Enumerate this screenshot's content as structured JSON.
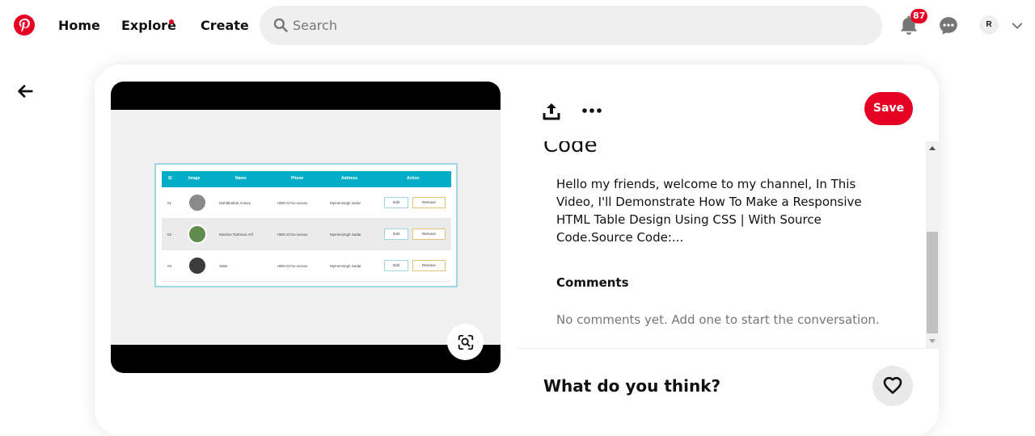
{
  "header": {
    "nav": {
      "home": "Home",
      "explore": "Explore",
      "create": "Create"
    },
    "search": {
      "placeholder": "Search",
      "value": ""
    },
    "notifications_count": "87",
    "avatar_initial": "R",
    "colors": {
      "brand": "#e60023",
      "search_bg": "#efefef"
    }
  },
  "pin": {
    "title": "Code",
    "description": "Hello my friends, welcome to my channel, In This Video, I'll Demonstrate How To Make a Responsive HTML Table Design Using CSS | With Source Code.Source Code:...",
    "save_label": "Save",
    "comments_heading": "Comments",
    "comments_empty": "No comments yet. Add one to start the conversation.",
    "prompt": "What do you think?",
    "scroll_position": 0.44
  },
  "image_table": {
    "headers": [
      "Sl",
      "Image",
      "Name",
      "Phone",
      "Address",
      "Action"
    ],
    "rows": [
      {
        "sl": "01",
        "name": "Muhibbullah Ansary",
        "phone": "+880 017xx-xxxxxx",
        "address": "Mymensingh sadar",
        "edit": "Edit",
        "remove": "Remove"
      },
      {
        "sl": "02",
        "name": "Moshior Rahman Arif",
        "phone": "+880 017xx-xxxxxx",
        "address": "Mymensingh Sadar",
        "edit": "Edit",
        "remove": "Remove"
      },
      {
        "sl": "03",
        "name": "Sabe",
        "phone": "+880 017xx-xxxxxx",
        "address": "Mymensingh Sadar",
        "edit": "Edit",
        "remove": "Remove"
      }
    ]
  },
  "icons": [
    "pinterest-logo-icon",
    "search-icon",
    "bell-icon",
    "chat-icon",
    "chevron-down-icon",
    "back-arrow-icon",
    "share-icon",
    "more-icon",
    "visual-search-icon",
    "heart-icon"
  ]
}
